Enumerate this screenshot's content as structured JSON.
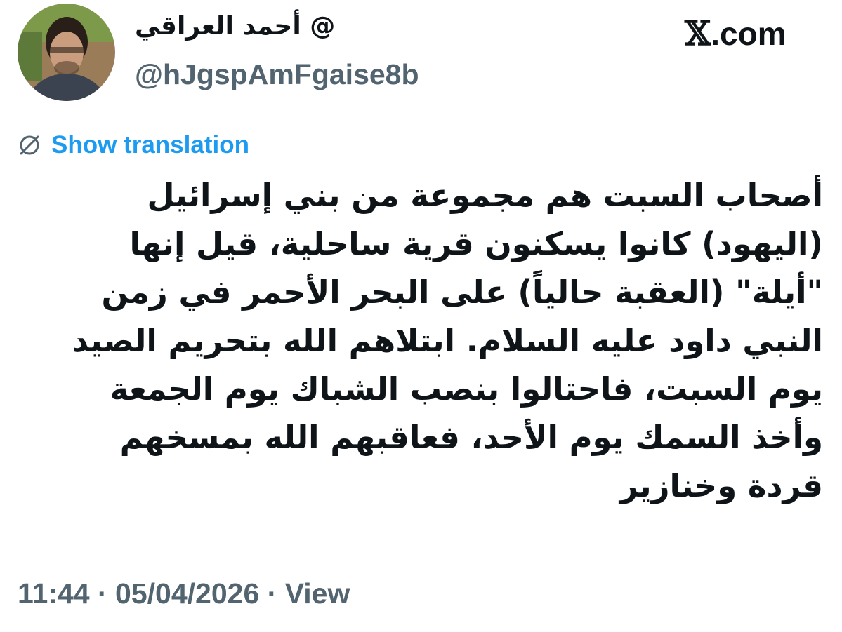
{
  "header": {
    "display_name": "أحمد العراقي @",
    "handle": "@hJgspAmFgaise8b",
    "brand_glyph": "𝕏",
    "brand_suffix": ".com"
  },
  "translation": {
    "icon": "globe-slash-icon",
    "label": "Show translation",
    "color": "#1d9bf0"
  },
  "tweet": {
    "lines": [
      "أصحاب السبت هم مجموعة من بني إسرائيل",
      "(اليهود) كانوا يسكنون قرية ساحلية، قيل إنها",
      "\"أيلة\" (العقبة حالياً) على البحر الأحمر في زمن",
      "النبي داود عليه السلام. ابتلاهم الله بتحريم الصيد",
      "يوم السبت، فاحتالوا بنصب الشباك يوم الجمعة",
      "وأخذ السمك يوم الأحد، فعاقبهم الله بمسخهم",
      "قردة وخنازير"
    ]
  },
  "meta": {
    "time": "11:44",
    "separator": " · ",
    "date": "05/04/2026",
    "views_label": "View"
  },
  "colors": {
    "text": "#0f1419",
    "secondary": "#536471",
    "link": "#1d9bf0"
  }
}
